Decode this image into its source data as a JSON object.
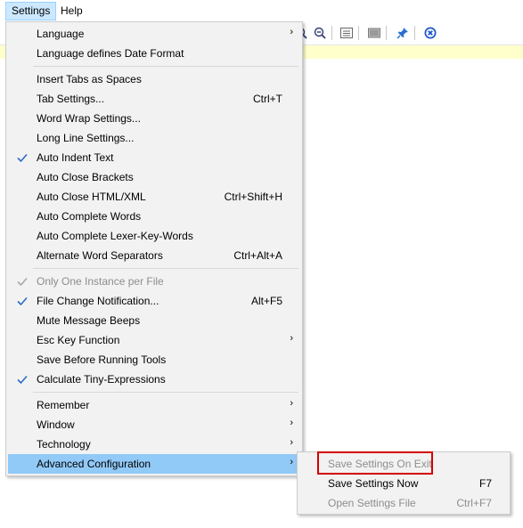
{
  "menubar": {
    "settings": "Settings",
    "help": "Help"
  },
  "menu": {
    "items": [
      {
        "label": "Language",
        "accel": "",
        "arrow": true,
        "checked": false,
        "disabled": false
      },
      {
        "label": "Language defines Date Format",
        "accel": "",
        "arrow": false,
        "checked": false,
        "disabled": false
      },
      {
        "label": "Insert Tabs as Spaces",
        "accel": "",
        "arrow": false,
        "checked": false,
        "disabled": false
      },
      {
        "label": "Tab Settings...",
        "accel": "Ctrl+T",
        "arrow": false,
        "checked": false,
        "disabled": false
      },
      {
        "label": "Word Wrap Settings...",
        "accel": "",
        "arrow": false,
        "checked": false,
        "disabled": false
      },
      {
        "label": "Long Line Settings...",
        "accel": "",
        "arrow": false,
        "checked": false,
        "disabled": false
      },
      {
        "label": "Auto Indent Text",
        "accel": "",
        "arrow": false,
        "checked": true,
        "disabled": false
      },
      {
        "label": "Auto Close Brackets",
        "accel": "",
        "arrow": false,
        "checked": false,
        "disabled": false
      },
      {
        "label": "Auto Close HTML/XML",
        "accel": "Ctrl+Shift+H",
        "arrow": false,
        "checked": false,
        "disabled": false
      },
      {
        "label": "Auto Complete Words",
        "accel": "",
        "arrow": false,
        "checked": false,
        "disabled": false
      },
      {
        "label": "Auto Complete Lexer-Key-Words",
        "accel": "",
        "arrow": false,
        "checked": false,
        "disabled": false
      },
      {
        "label": "Alternate Word Separators",
        "accel": "Ctrl+Alt+A",
        "arrow": false,
        "checked": false,
        "disabled": false
      },
      {
        "label": "Only One Instance per File",
        "accel": "",
        "arrow": false,
        "checked": true,
        "disabled": true
      },
      {
        "label": "File Change Notification...",
        "accel": "Alt+F5",
        "arrow": false,
        "checked": true,
        "disabled": false
      },
      {
        "label": "Mute Message Beeps",
        "accel": "",
        "arrow": false,
        "checked": false,
        "disabled": false
      },
      {
        "label": "Esc Key Function",
        "accel": "",
        "arrow": true,
        "checked": false,
        "disabled": false
      },
      {
        "label": "Save Before Running Tools",
        "accel": "",
        "arrow": false,
        "checked": false,
        "disabled": false
      },
      {
        "label": "Calculate Tiny-Expressions",
        "accel": "",
        "arrow": false,
        "checked": true,
        "disabled": false
      },
      {
        "label": "Remember",
        "accel": "",
        "arrow": true,
        "checked": false,
        "disabled": false
      },
      {
        "label": "Window",
        "accel": "",
        "arrow": true,
        "checked": false,
        "disabled": false
      },
      {
        "label": "Technology",
        "accel": "",
        "arrow": true,
        "checked": false,
        "disabled": false
      },
      {
        "label": "Advanced Configuration",
        "accel": "",
        "arrow": true,
        "checked": false,
        "disabled": false,
        "highlighted": true
      }
    ]
  },
  "submenu": {
    "items": [
      {
        "label": "Save Settings On Exit",
        "accel": "",
        "disabled": true
      },
      {
        "label": "Save Settings Now",
        "accel": "F7",
        "disabled": false
      },
      {
        "label": "Open Settings File",
        "accel": "Ctrl+F7",
        "disabled": true
      }
    ]
  },
  "icons": {
    "zoom_in": "zoom-in-icon",
    "zoom_out": "zoom-out-icon",
    "view": "view-icon",
    "screen": "screen-icon",
    "pin": "pin-icon",
    "close": "close-circle-icon",
    "check": "check-icon",
    "arrow": "chevron-right-icon"
  },
  "colors": {
    "menu_bg": "#f2f2f2",
    "highlight": "#91c9f7",
    "check": "#2b6cc4",
    "current_line": "#ffffcc",
    "callout": "#d40000",
    "active_menubar": "#cce8ff"
  }
}
